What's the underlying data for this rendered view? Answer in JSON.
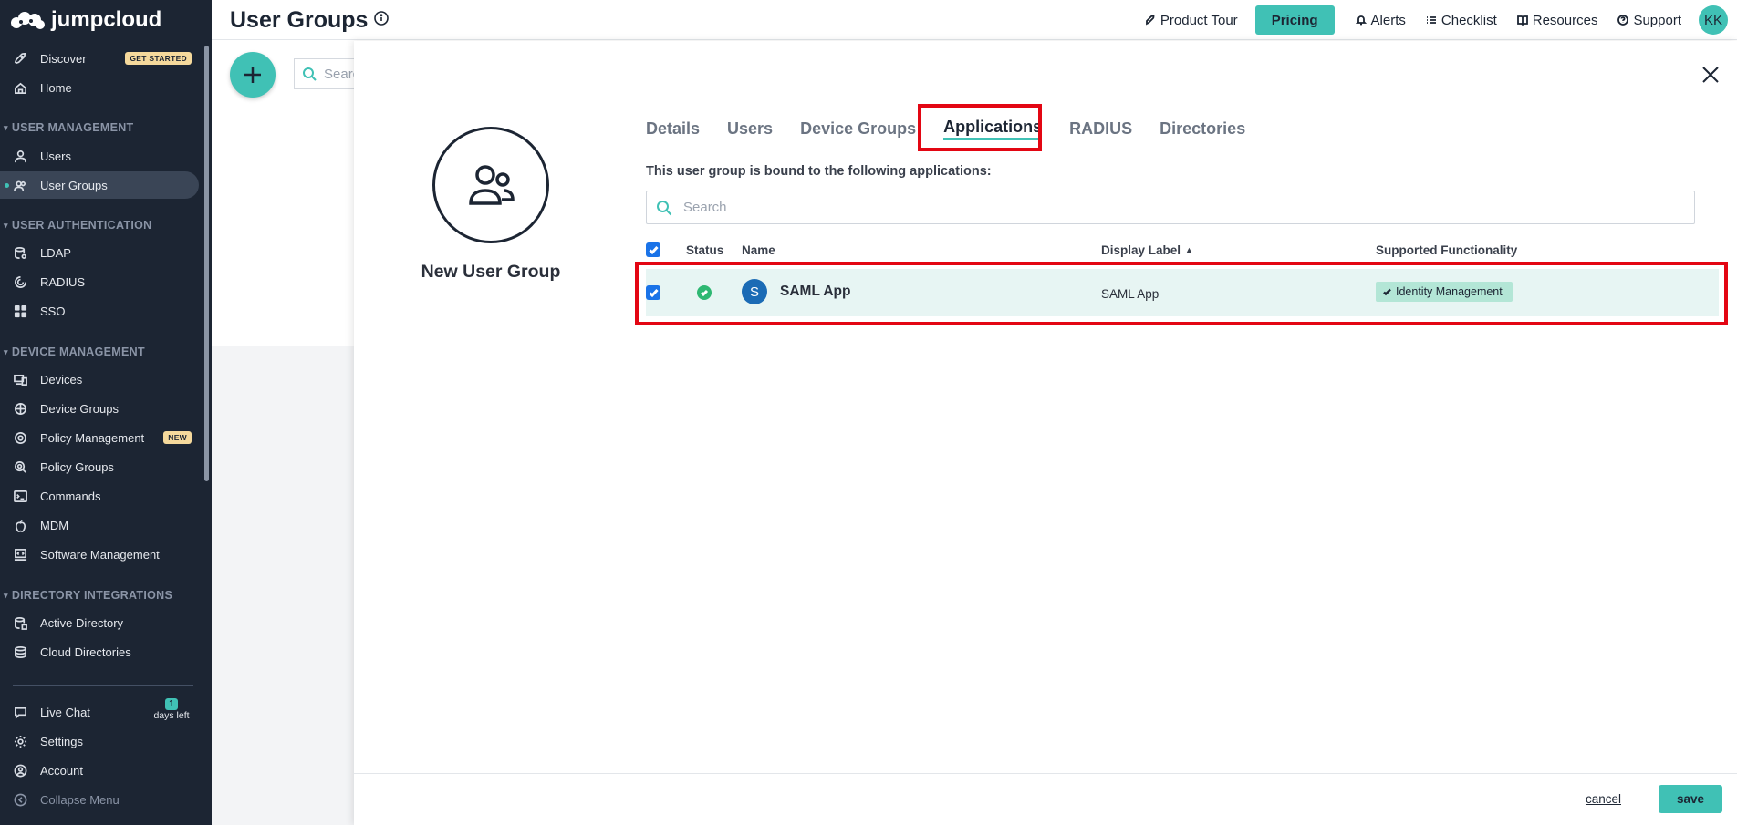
{
  "brand": {
    "name": "jumpcloud"
  },
  "sidebar": {
    "items": [
      {
        "label": "Discover",
        "icon": "rocket-icon",
        "badge": "GET STARTED"
      },
      {
        "label": "Home",
        "icon": "home-icon"
      },
      {
        "label": "Users",
        "icon": "user-icon"
      },
      {
        "label": "User Groups",
        "icon": "user-groups-icon"
      },
      {
        "label": "LDAP",
        "icon": "ldap-icon"
      },
      {
        "label": "RADIUS",
        "icon": "radius-icon"
      },
      {
        "label": "SSO",
        "icon": "sso-icon"
      },
      {
        "label": "Devices",
        "icon": "devices-icon"
      },
      {
        "label": "Device Groups",
        "icon": "device-groups-icon"
      },
      {
        "label": "Policy Management",
        "icon": "policy-icon",
        "badge": "NEW"
      },
      {
        "label": "Policy Groups",
        "icon": "policy-groups-icon"
      },
      {
        "label": "Commands",
        "icon": "commands-icon"
      },
      {
        "label": "MDM",
        "icon": "apple-icon"
      },
      {
        "label": "Software Management",
        "icon": "software-icon"
      },
      {
        "label": "Active Directory",
        "icon": "active-directory-icon"
      },
      {
        "label": "Cloud Directories",
        "icon": "cloud-directories-icon"
      }
    ],
    "sections": [
      "USER MANAGEMENT",
      "USER AUTHENTICATION",
      "DEVICE MANAGEMENT",
      "DIRECTORY INTEGRATIONS"
    ],
    "bottom": {
      "live_chat": "Live Chat",
      "settings": "Settings",
      "account": "Account",
      "collapse": "Collapse Menu",
      "trial_count": "1",
      "trial_text": "days left"
    }
  },
  "header": {
    "title": "User Groups",
    "product_tour": "Product Tour",
    "pricing": "Pricing",
    "alerts": "Alerts",
    "checklist": "Checklist",
    "resources": "Resources",
    "support": "Support",
    "avatar_initials": "KK"
  },
  "background": {
    "search_placeholder": "Search"
  },
  "drawer": {
    "group_name": "New User Group",
    "tabs": [
      "Details",
      "Users",
      "Device Groups",
      "Applications",
      "RADIUS",
      "Directories"
    ],
    "active_tab": "Applications",
    "bound_text": "This user group is bound to the following applications:",
    "search_placeholder": "Search",
    "table": {
      "headers": {
        "status": "Status",
        "name": "Name",
        "display_label": "Display Label",
        "functionality": "Supported Functionality"
      },
      "rows": [
        {
          "logo_letter": "S",
          "name": "SAML App",
          "display_label": "SAML App",
          "functionality": "Identity Management",
          "checked": true,
          "status": "ok"
        }
      ]
    },
    "footer": {
      "cancel": "cancel",
      "save": "save"
    }
  },
  "colors": {
    "accent": "#40c1b5",
    "sidebar": "#1c2533",
    "highlight": "#e30613",
    "row_selected": "#e7f5f3",
    "checkbox": "#1a73e8"
  }
}
